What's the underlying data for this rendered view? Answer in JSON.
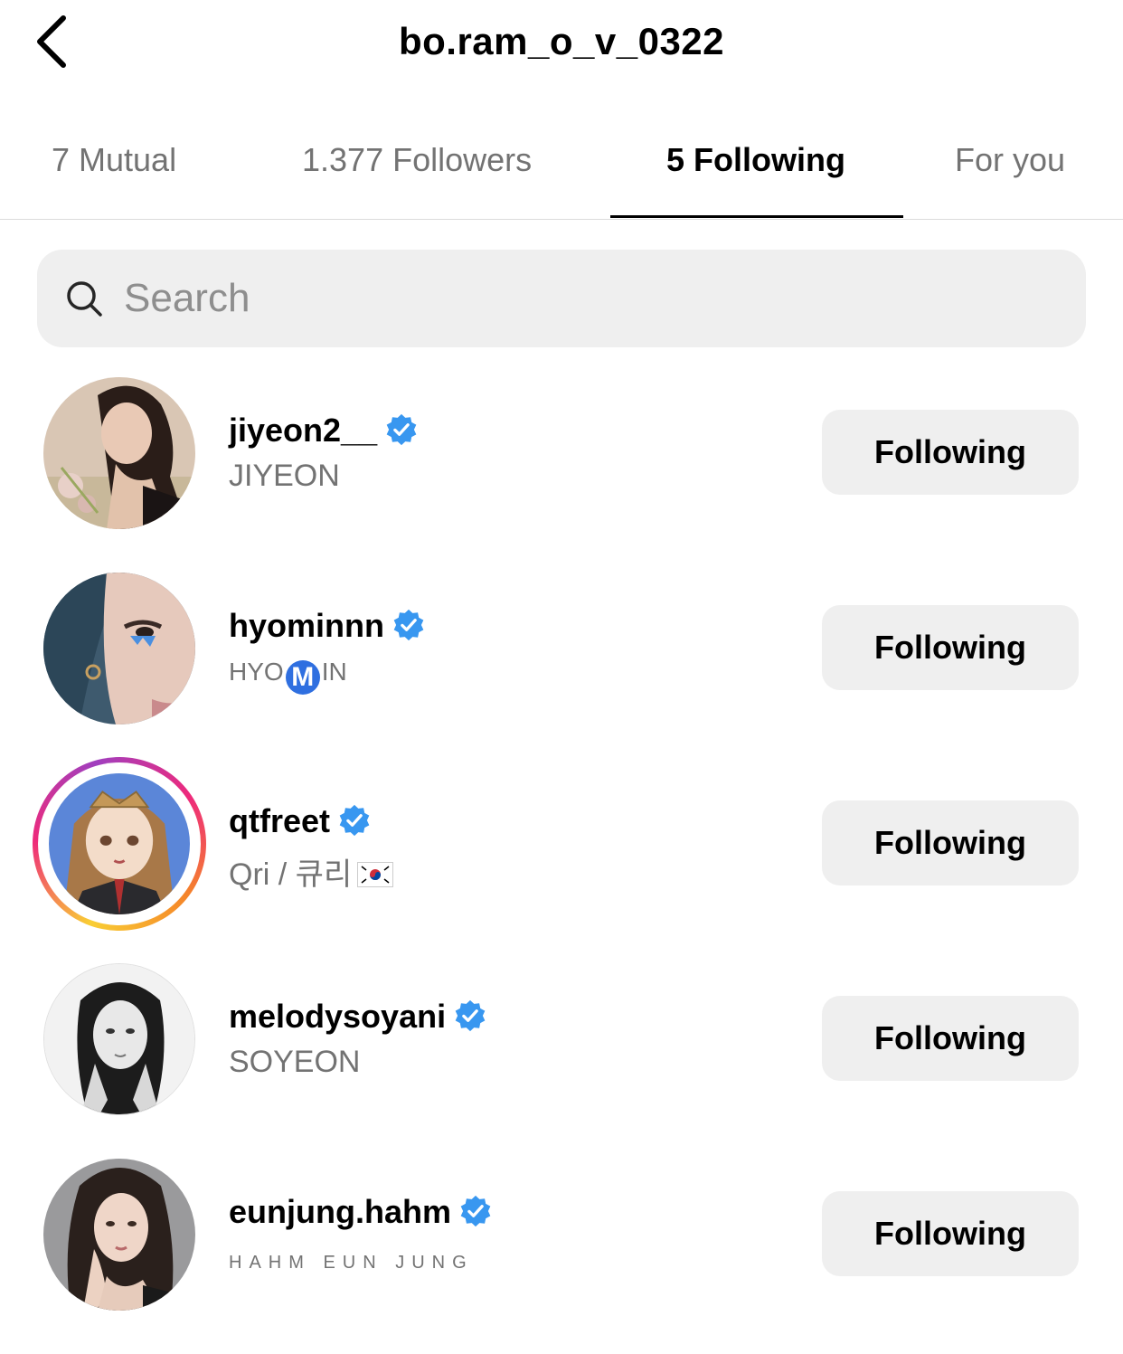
{
  "header": {
    "title": "bo.ram_o_v_0322",
    "back_icon": "chevron-left-icon"
  },
  "tabs": [
    {
      "label": "7 Mutual",
      "active": false
    },
    {
      "label": "1.377 Followers",
      "active": false
    },
    {
      "label": "5 Following",
      "active": true
    },
    {
      "label": "For you",
      "active": false
    }
  ],
  "search": {
    "placeholder": "Search",
    "value": "",
    "icon": "search-icon"
  },
  "accounts": [
    {
      "username": "jiyeon2__",
      "fullname": "JIYEON",
      "verified": true,
      "button_label": "Following"
    },
    {
      "username": "hyominnn",
      "fullname_prefix": "HYO",
      "fullname_badge": "M",
      "fullname_suffix": "IN",
      "verified": true,
      "button_label": "Following"
    },
    {
      "username": "qtfreet",
      "fullname": "Qri / 큐리",
      "has_story": true,
      "verified": true,
      "button_label": "Following"
    },
    {
      "username": "melodysoyani",
      "fullname": "SOYEON",
      "verified": true,
      "button_label": "Following"
    },
    {
      "username": "eunjung.hahm",
      "fullname": "HAHM EUN JUNG",
      "verified": true,
      "button_label": "Following"
    }
  ],
  "colors": {
    "verified_blue": "#3897f0",
    "secondary_text": "#737373",
    "button_bg": "#efefef",
    "search_bg": "#efefef"
  }
}
